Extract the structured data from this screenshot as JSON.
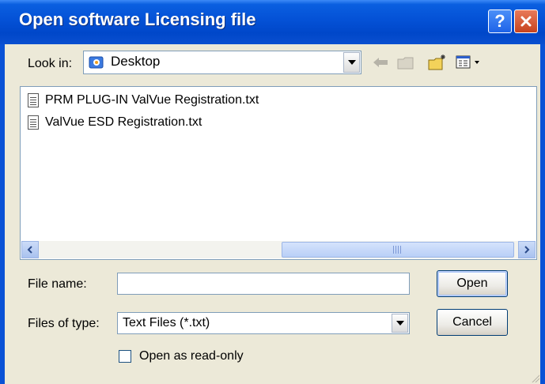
{
  "window": {
    "title": "Open software Licensing file"
  },
  "titlebar": {
    "help_label": "?"
  },
  "lookin": {
    "label": "Look in:",
    "value": "Desktop"
  },
  "toolbar": {
    "icons": [
      "back-arrow-icon",
      "up-folder-icon",
      "new-folder-icon",
      "view-menu-icon"
    ]
  },
  "files": [
    {
      "name": "PRM PLUG-IN ValVue Registration.txt",
      "icon": "text-file-icon"
    },
    {
      "name": "ValVue ESD Registration.txt",
      "icon": "text-file-icon"
    }
  ],
  "filename": {
    "label": "File name:",
    "value": ""
  },
  "filetype": {
    "label": "Files of type:",
    "value": "Text Files (*.txt)"
  },
  "buttons": {
    "open": "Open",
    "cancel": "Cancel"
  },
  "readonly": {
    "label": "Open as read-only",
    "checked": false
  },
  "colors": {
    "title_blue": "#0451d6",
    "dialog_bg": "#ece9d8",
    "close_red": "#c7431f"
  }
}
